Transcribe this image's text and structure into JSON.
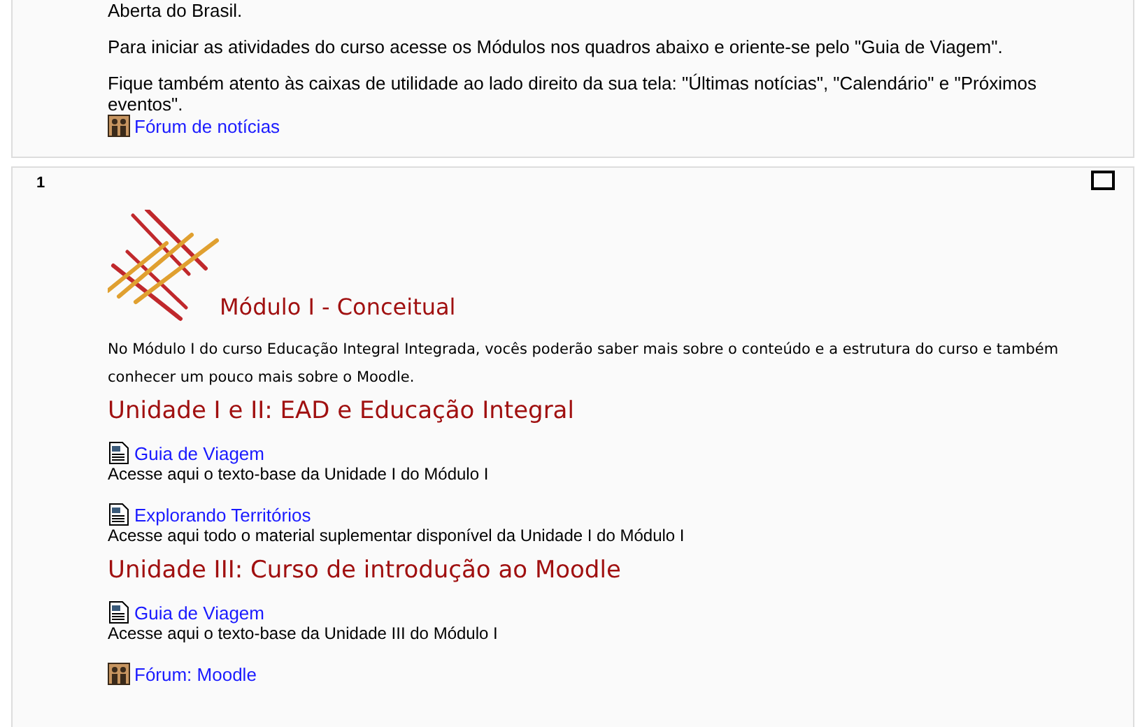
{
  "intro_section": {
    "paragraphs": [
      "Aberta do Brasil.",
      "Para iniciar as atividades do curso acesse os Módulos nos quadros abaixo e oriente-se pelo \"Guia de Viagem\".",
      "Fique também atento às caixas de utilidade ao lado direito da sua tela: \"Últimas notícias\", \"Calendário\" e \"Próximos eventos\"."
    ],
    "links": [
      {
        "kind": "forum",
        "label": "Fórum de notícias"
      }
    ]
  },
  "module_section": {
    "number": "1",
    "title": "Módulo I - Conceitual",
    "summary": "No Módulo I do curso Educação Integral Integrada, vocês poderão saber mais sobre o conteúdo e a estrutura do curso e também conhecer um pouco mais sobre o Moodle.",
    "blocks": [
      {
        "kind": "heading",
        "text": "Unidade I e II: EAD e Educação Integral"
      },
      {
        "kind": "resource",
        "label": "Guia de Viagem",
        "description": "Acesse aqui o texto-base da Unidade I do Módulo I"
      },
      {
        "kind": "resource",
        "label": "Explorando Territórios",
        "description": "Acesse aqui todo o material suplementar disponível da Unidade I do Módulo I"
      },
      {
        "kind": "heading",
        "text": "Unidade III: Curso de introdução ao Moodle"
      },
      {
        "kind": "resource",
        "label": "Guia de Viagem",
        "description": "Acesse aqui o texto-base da Unidade III do Módulo I"
      },
      {
        "kind": "forum",
        "label": "Fórum: Moodle"
      }
    ]
  }
}
